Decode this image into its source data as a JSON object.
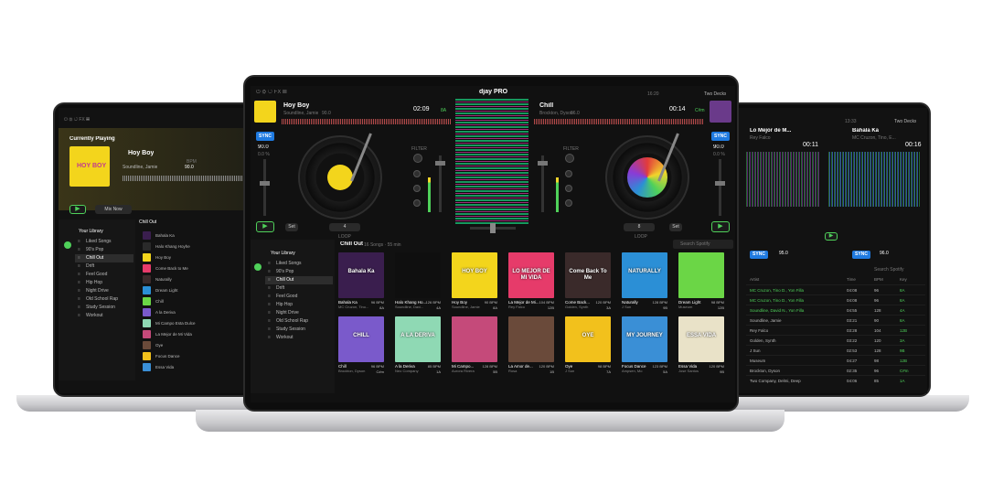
{
  "left_laptop": {
    "currently_playing": "Currently Playing",
    "track_title": "Hoy Boy",
    "track_artist": "Soundline, Jamie",
    "bpm_label": "BPM",
    "bpm_value": "90.0",
    "mix_now": "Mix Now",
    "sidebar_title": "Your Library",
    "sidebar_items": [
      "Liked Songs",
      "90's Pop",
      "Chill Out",
      "Drift",
      "Feel Good",
      "Hip Hop",
      "Night Drive",
      "Old School Rap",
      "Study Session",
      "Workout"
    ],
    "playlist_title": "Chill Out",
    "tracks": [
      "Bahala Ka",
      "Halo Khang Hoyhe",
      "Hoy Boy",
      "Come Back to Me",
      "Naturally",
      "Dream Light",
      "Chill",
      "A la Deriva",
      "Mi Campo Esta Dulce",
      "La Mejor de Mi Vida",
      "Oye",
      "Focus Dance",
      "Essa Vida"
    ]
  },
  "center": {
    "app_name": "djay PRO",
    "clock": "16:20",
    "deck_mode": "Two Decks",
    "deck_left": {
      "title": "Hoy Boy",
      "artist": "Soundline, Jamie",
      "bpm": "90.0",
      "time": "02:09",
      "key": "8A",
      "tempo": "90.0",
      "tempo_pct": "0.0 %",
      "loop_value": "4",
      "set_label": "Set"
    },
    "deck_right": {
      "title": "Chill",
      "artist": "Brockton, Dyson",
      "bpm": "96.0",
      "time": "00:14",
      "key": "C#m",
      "tempo": "90.0",
      "tempo_pct": "0.0 %",
      "loop_value": "8",
      "set_label": "Set"
    },
    "sync_label": "SYNC",
    "filter_label": "FILTER",
    "loop_label": "LOOP",
    "library_title": "Your Library",
    "library_items": [
      "Liked Songs",
      "90's Pop",
      "Chill Out",
      "Drift",
      "Feel Good",
      "Hip Hop",
      "Night Drive",
      "Old School Rap",
      "Study Session",
      "Workout"
    ],
    "playlist_name": "Chill Out",
    "playlist_meta": "16 Songs · 55 min",
    "search_placeholder": "Search Spotify",
    "albums": [
      {
        "title": "Bahala Ka",
        "artist": "MC Cruzon, Tino...",
        "bpm": "96 BPM",
        "key": "8A",
        "color": "#3a1e4e",
        "art_text": "Bahala Ka"
      },
      {
        "title": "Halo Khang Ho...",
        "artist": "Soundline, Davi...",
        "bpm": "126 BPM",
        "key": "4A",
        "color": "#0f0f0f",
        "art_text": ""
      },
      {
        "title": "Hoy Boy",
        "artist": "Soundline, Jamie",
        "bpm": "90 BPM",
        "key": "8A",
        "color": "#f3d51c",
        "art_text": "HOY BOY"
      },
      {
        "title": "La Mejor de Mi...",
        "artist": "Rey Falco",
        "bpm": "104 BPM",
        "key": "12B",
        "color": "#e63b6a",
        "art_text": "LO MEJOR DE MI VIDA"
      },
      {
        "title": "Come Back...",
        "artist": "Golden, Synth",
        "bpm": "120 BPM",
        "key": "3A",
        "color": "#3a2a2a",
        "art_text": "Come Back To Me"
      },
      {
        "title": "Naturally",
        "artist": "J Sun",
        "bpm": "128 BPM",
        "key": "9B",
        "color": "#2b8fd6",
        "art_text": "NATURALLY"
      },
      {
        "title": "Dream Light",
        "artist": "Museum",
        "bpm": "98 BPM",
        "key": "12B",
        "color": "#6bd646",
        "art_text": ""
      },
      {
        "title": "Chill",
        "artist": "Brockton, Dyson",
        "bpm": "96 BPM",
        "key": "C#m",
        "color": "#7a5acb",
        "art_text": "CHILL"
      },
      {
        "title": "A la Deriva",
        "artist": "Neo Company",
        "bpm": "85 BPM",
        "key": "1A",
        "color": "#8fd9b4",
        "art_text": "A LA DERIVA"
      },
      {
        "title": "Mi Campo...",
        "artist": "Aurora Rivera",
        "bpm": "128 BPM",
        "key": "5B",
        "color": "#c54a7a",
        "art_text": ""
      },
      {
        "title": "La Amor de...",
        "artist": "Rosa",
        "bpm": "120 BPM",
        "key": "1B",
        "color": "#6a4a3a",
        "art_text": ""
      },
      {
        "title": "Oye",
        "artist": "J Sun",
        "bpm": "98 BPM",
        "key": "7A",
        "color": "#f2c11c",
        "art_text": "OYE"
      },
      {
        "title": "Focus Dance",
        "artist": "Ampsen, Mo",
        "bpm": "123 BPM",
        "key": "5A",
        "color": "#3a8fd6",
        "art_text": "MY JOURNEY"
      },
      {
        "title": "Essa Vida",
        "artist": "Jose Santos",
        "bpm": "120 BPM",
        "key": "9B",
        "color": "#e9e2c8",
        "art_text": "ESSA VIDA"
      }
    ]
  },
  "right_laptop": {
    "deck_left_title": "Lo Mejor de M...",
    "deck_left_artist": "Rey Falco",
    "deck_left_time": "00:11",
    "deck_right_title": "Bahala Ka",
    "deck_right_artist": "MC Cruzon, Tino, E...",
    "deck_right_time": "00:16",
    "deck_mode": "Two Decks",
    "clock": "13:33",
    "tempo_left": "95.0",
    "tempo_right": "96.0",
    "sync_label": "SYNC",
    "search_placeholder": "Search Spotify",
    "table_header": [
      "Artist",
      "Time",
      "BPM",
      "Key"
    ],
    "rows": [
      {
        "artist": "MC Cruzon, Tino D., Yon Filla",
        "time": "04:08",
        "bpm": "96",
        "key": "8A"
      },
      {
        "artist": "MC Cruzon, Tino D., Yon Filla",
        "time": "04:08",
        "bpm": "96",
        "key": "8A"
      },
      {
        "artist": "Soundline, David N., Yon Filla",
        "time": "04:55",
        "bpm": "128",
        "key": "4A"
      },
      {
        "artist": "Soundline, Jamie",
        "time": "03:21",
        "bpm": "90",
        "key": "8A"
      },
      {
        "artist": "Rey Falco",
        "time": "03:28",
        "bpm": "104",
        "key": "12B"
      },
      {
        "artist": "Golden, Synth",
        "time": "03:22",
        "bpm": "120",
        "key": "3A"
      },
      {
        "artist": "J Sun",
        "time": "02:53",
        "bpm": "128",
        "key": "9B"
      },
      {
        "artist": "Museum",
        "time": "04:27",
        "bpm": "98",
        "key": "12B"
      },
      {
        "artist": "Brockton, Dyson",
        "time": "02:35",
        "bpm": "96",
        "key": "C#m"
      },
      {
        "artist": "Two Company, Delmi, Deep",
        "time": "04:06",
        "bpm": "85",
        "key": "1A"
      }
    ]
  }
}
